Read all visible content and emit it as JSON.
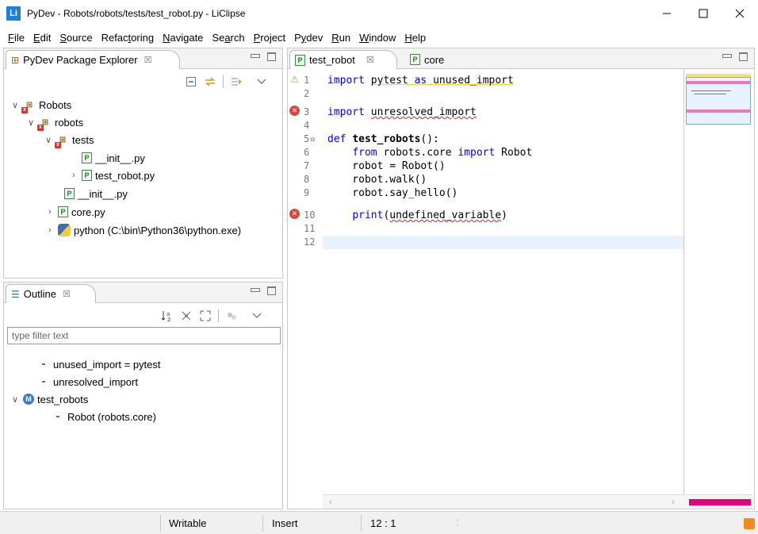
{
  "window": {
    "app_icon": "Li",
    "title": "PyDev - Robots/robots/tests/test_robot.py - LiClipse",
    "controls": [
      "minimize-icon",
      "maximize-icon",
      "close-icon"
    ]
  },
  "menu": [
    {
      "hotkey": "F",
      "rest": "ile"
    },
    {
      "hotkey": "E",
      "rest": "dit"
    },
    {
      "hotkey": "S",
      "rest": "ource"
    },
    {
      "pre": "Refac",
      "hotkey": "t",
      "rest": "oring"
    },
    {
      "hotkey": "N",
      "rest": "avigate"
    },
    {
      "pre": "Se",
      "hotkey": "a",
      "rest": "rch"
    },
    {
      "hotkey": "P",
      "rest": "roject"
    },
    {
      "pre": "P",
      "hotkey": "y",
      "rest": "dev"
    },
    {
      "hotkey": "R",
      "rest": "un"
    },
    {
      "hotkey": "W",
      "rest": "indow"
    },
    {
      "hotkey": "H",
      "rest": "elp"
    }
  ],
  "package_explorer": {
    "tab_label": "PyDev Package Explorer",
    "tab_close": "☒",
    "tree": [
      {
        "label": "Robots",
        "chevron": "∨",
        "icon": "project-icon"
      },
      {
        "label": "robots",
        "chevron": "∨",
        "icon": "package-icon"
      },
      {
        "label": "tests",
        "chevron": "∨",
        "icon": "package-icon"
      },
      {
        "label": "__init__.py",
        "chevron": "",
        "icon": "python-file-icon"
      },
      {
        "label": "test_robot.py",
        "chevron": "›",
        "icon": "python-file-icon"
      },
      {
        "label": "__init__.py",
        "chevron": "",
        "icon": "python-file-icon"
      },
      {
        "label": "core.py",
        "chevron": "›",
        "icon": "python-file-icon"
      },
      {
        "label": "python  (C:\\bin\\Python36\\python.exe)",
        "chevron": "›",
        "icon": "python-interpreter-icon"
      }
    ]
  },
  "outline": {
    "tab_label": "Outline",
    "tab_close": "☒",
    "filter_placeholder": "type filter text",
    "tree": [
      {
        "label": "unused_import = pytest",
        "chevron": "",
        "icon": "variable-icon"
      },
      {
        "label": "unresolved_import",
        "chevron": "",
        "icon": "variable-icon"
      },
      {
        "label": "test_robots",
        "chevron": "∨",
        "icon": "function-icon"
      },
      {
        "label": "Robot (robots.core)",
        "chevron": "",
        "icon": "variable-icon"
      }
    ]
  },
  "editor": {
    "tabs": [
      {
        "label": "test_robot",
        "close": "☒",
        "active": true
      },
      {
        "label": "core",
        "close": "",
        "active": false
      }
    ],
    "line_numbers": [
      "1",
      "2",
      "3",
      "4",
      "5",
      "6",
      "7",
      "8",
      "9",
      "10",
      "11",
      "12"
    ],
    "code": {
      "l1_kw": "import",
      "l1_a": " ",
      "l1_b": "pytest",
      "l1_c": " ",
      "l1_d": "as",
      "l1_e": " ",
      "l1_f": "unused_import",
      "l3_kw": "import",
      "l3_sp": " ",
      "l3_b": "unresolved_import",
      "l5_kw": "def",
      "l5_sp": " ",
      "l5_fn": "test_robots",
      "l5_rest": "():",
      "l6_ind": "    ",
      "l6_kw1": "from",
      "l6_mid": " robots.core ",
      "l6_kw2": "import",
      "l6_rest": " Robot",
      "l7": "    robot = Robot()",
      "l8": "    robot.walk()",
      "l9": "    robot.say_hello()",
      "l10_ind": "    ",
      "l10_kw": "print",
      "l10_open": "(",
      "l10_var": "undefined_variable",
      "l10_close": ")"
    },
    "fold_marker": "⊖",
    "cursor_line": 12,
    "colors": {
      "keyword": "#0000ff",
      "error": "#d9473e",
      "warning": "#d2a000",
      "current_line": "#e8f2fe",
      "overview_error": "#e6007e"
    }
  },
  "status": {
    "writable": "Writable",
    "insert_mode": "Insert",
    "position": "12 : 1"
  }
}
